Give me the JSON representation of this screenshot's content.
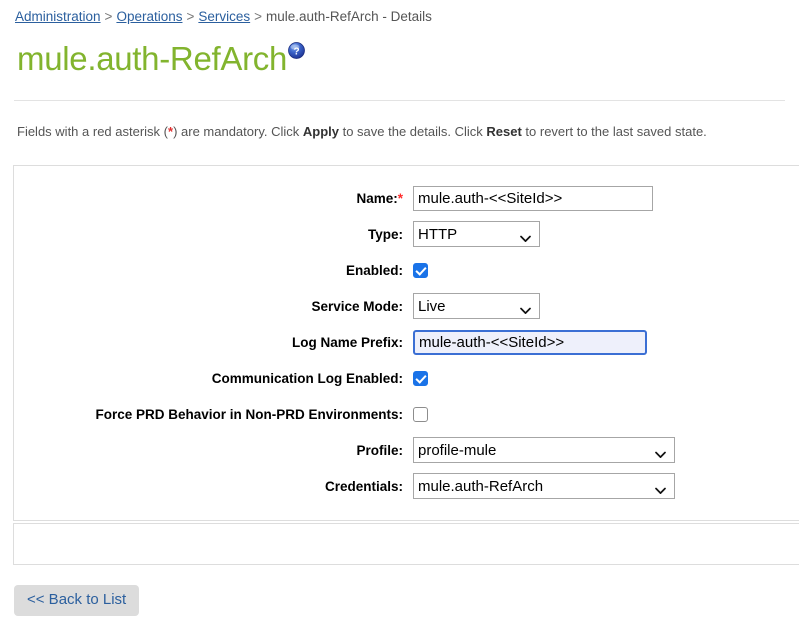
{
  "breadcrumb": {
    "items": [
      {
        "label": "Administration",
        "link": true
      },
      {
        "label": "Operations",
        "link": true
      },
      {
        "label": "Services",
        "link": true
      },
      {
        "label": "mule.auth-RefArch - Details",
        "link": false
      }
    ],
    "separator": ">"
  },
  "header": {
    "title": "mule.auth-RefArch",
    "title_color": "#82b42e",
    "help_icon": "help-question-icon"
  },
  "instructions": {
    "part1": "Fields with a red asterisk (",
    "asterisk": "*",
    "part2": ") are mandatory. Click ",
    "apply": "Apply",
    "part3": " to save the details. Click ",
    "reset": "Reset",
    "part4": " to revert to the last saved state."
  },
  "form": {
    "required_marker": "*",
    "fields": [
      {
        "label": "Name:",
        "required": true,
        "control": "text",
        "value": "mule.auth-<<SiteId>>",
        "focused": false
      },
      {
        "label": "Type:",
        "required": false,
        "control": "select",
        "value": "HTTP",
        "options": [
          "HTTP"
        ]
      },
      {
        "label": "Enabled:",
        "required": false,
        "control": "checkbox",
        "checked": true
      },
      {
        "label": "Service Mode:",
        "required": false,
        "control": "select",
        "value": "Live",
        "options": [
          "Live"
        ]
      },
      {
        "label": "Log Name Prefix:",
        "required": false,
        "control": "text",
        "value": "mule-auth-<<SiteId>>",
        "focused": true
      },
      {
        "label": "Communication Log Enabled:",
        "required": false,
        "control": "checkbox",
        "checked": true
      },
      {
        "label": "Force PRD Behavior in Non-PRD Environments:",
        "required": false,
        "control": "checkbox",
        "checked": false
      },
      {
        "label": "Profile:",
        "required": false,
        "control": "select",
        "value": "profile-mule",
        "options": [
          "profile-mule"
        ]
      },
      {
        "label": "Credentials:",
        "required": false,
        "control": "select",
        "value": "mule.auth-RefArch",
        "options": [
          "mule.auth-RefArch"
        ]
      }
    ]
  },
  "footer": {
    "back_button": "<< Back to List"
  },
  "colors": {
    "link": "#2b5f9e",
    "title_green": "#82b42e",
    "required_red": "#ff2a2a",
    "checkbox_blue": "#1a73e8",
    "focus_border": "#3b6fd4",
    "focus_fill": "#eef0fb",
    "button_bg": "#dcdcdc"
  }
}
